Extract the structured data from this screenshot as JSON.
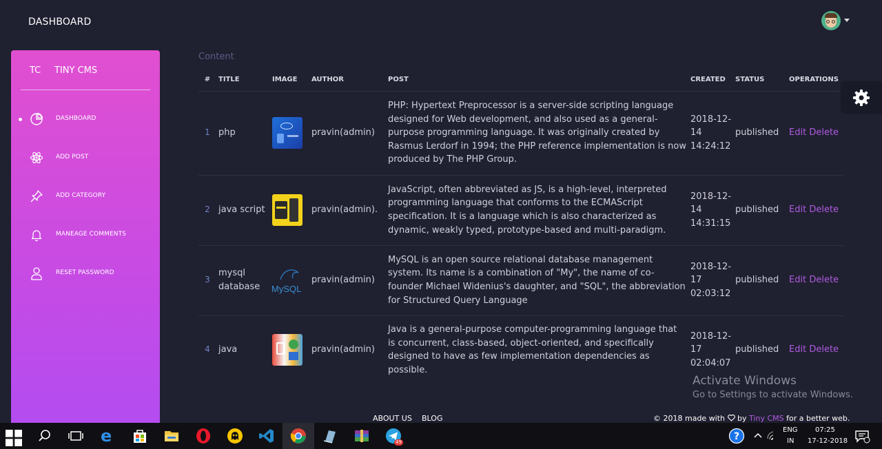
{
  "header": {
    "title": "DASHBOARD"
  },
  "sidebar": {
    "logo": "TC",
    "name": "TINY CMS",
    "items": [
      {
        "label": "DASHBOARD",
        "icon": "pie-chart-icon",
        "active": true
      },
      {
        "label": "ADD POST",
        "icon": "atom-icon"
      },
      {
        "label": "ADD CATEGORY",
        "icon": "pin-icon"
      },
      {
        "label": "MANEAGE COMMENTS",
        "icon": "bell-icon"
      },
      {
        "label": "RESET PASSWORD",
        "icon": "user-icon"
      }
    ]
  },
  "content": {
    "title": "Content",
    "columns": [
      "#",
      "TITLE",
      "IMAGE",
      "AUTHOR",
      "POST",
      "CREATED",
      "STATUS",
      "OPERATIONS"
    ],
    "rows": [
      {
        "num": "1",
        "title": "php",
        "image": "php-thumbnail",
        "author": "pravin(admin)",
        "post": "PHP: Hypertext Preprocessor is a server-side scripting language designed for Web development, and also used as a general-purpose programming language. It was originally created by Rasmus Lerdorf in 1994; the PHP reference implementation is now produced by The PHP Group.",
        "created": "2018-12-14 14:24:12",
        "status": "published",
        "edit": "Edit",
        "delete": "Delete"
      },
      {
        "num": "2",
        "title": "java script",
        "image": "javascript-thumbnail",
        "author": "pravin(admin).",
        "post": "JavaScript, often abbreviated as JS, is a high-level, interpreted programming language that conforms to the ECMAScript specification. It is a language which is also characterized as dynamic, weakly typed, prototype-based and multi-paradigm.",
        "created": "2018-12-14 14:31:15",
        "status": "published",
        "edit": "Edit",
        "delete": "Delete"
      },
      {
        "num": "3",
        "title": "mysql database",
        "image": "mysql-thumbnail",
        "image_text": "MySQL",
        "author": "pravin(admin)",
        "post": "MySQL is an open source relational database management system. Its name is a combination of \"My\", the name of co-founder Michael Widenius's daughter, and \"SQL\", the abbreviation for Structured Query Language",
        "created": "2018-12-17 02:03:12",
        "status": "published",
        "edit": "Edit",
        "delete": "Delete"
      },
      {
        "num": "4",
        "title": "java",
        "image": "java-thumbnail",
        "author": "pravin(admin)",
        "post": "Java is a general-purpose computer-programming language that is concurrent, class-based, object-oriented, and specifically designed to have as few implementation dependencies as possible.",
        "created": "2018-12-17 02:04:07",
        "status": "published",
        "edit": "Edit",
        "delete": "Delete"
      }
    ]
  },
  "watermark": {
    "line1": "Activate Windows",
    "line2": "Go to Settings to activate Windows."
  },
  "footer": {
    "about": "ABOUT US",
    "blog": "BLOG",
    "copy_prefix": "© 2018 made with",
    "copy_by": "by",
    "copy_brand": "Tiny CMS",
    "copy_suffix": "for a better web."
  },
  "taskbar": {
    "language": "ENG",
    "region": "IN",
    "time": "07:25",
    "date": "17-12-2018",
    "badge": "49"
  },
  "colors": {
    "background": "#1f2030",
    "accent": "#b05be0",
    "sidebar_top": "#e14fd0",
    "sidebar_bottom": "#b34cf0"
  }
}
